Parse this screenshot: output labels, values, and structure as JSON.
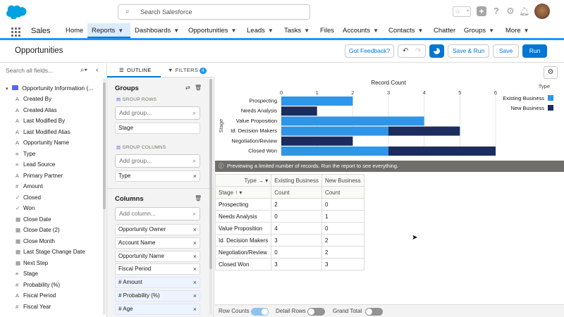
{
  "topbar": {
    "search_placeholder": "Search Salesforce",
    "icons": [
      "plus-icon",
      "help-icon",
      "gear-icon",
      "bell-icon"
    ]
  },
  "nav": {
    "app_name": "Sales",
    "items": [
      "Home",
      "Reports",
      "Dashboards",
      "Opportunities",
      "Leads",
      "Tasks",
      "Files",
      "Accounts",
      "Contacts",
      "Chatter",
      "Groups",
      "More"
    ]
  },
  "header": {
    "title": "Opportunities",
    "feedback": "Got Feedback?",
    "save_run": "Save & Run",
    "save": "Save",
    "run": "Run"
  },
  "fields": {
    "search_placeholder": "Search all fields...",
    "folder": "Opportunity Information (...",
    "items": [
      {
        "icon": "A",
        "label": "Created By"
      },
      {
        "icon": "A",
        "label": "Created Alias"
      },
      {
        "icon": "A",
        "label": "Last Modified By"
      },
      {
        "icon": "A",
        "label": "Last Modified Alias"
      },
      {
        "icon": "A",
        "label": "Opportunity Name"
      },
      {
        "icon": "≡",
        "label": "Type"
      },
      {
        "icon": "≡",
        "label": "Lead Source"
      },
      {
        "icon": "A",
        "label": "Primary Partner"
      },
      {
        "icon": "#",
        "label": "Amount"
      },
      {
        "icon": "✓",
        "label": "Closed"
      },
      {
        "icon": "✓",
        "label": "Won"
      },
      {
        "icon": "▦",
        "label": "Close Date"
      },
      {
        "icon": "▦",
        "label": "Close Date (2)"
      },
      {
        "icon": "▦",
        "label": "Close Month"
      },
      {
        "icon": "▦",
        "label": "Last Stage Change Date"
      },
      {
        "icon": "▦",
        "label": "Next Step"
      },
      {
        "icon": "≡",
        "label": "Stage"
      },
      {
        "icon": "#",
        "label": "Probability (%)"
      },
      {
        "icon": "A",
        "label": "Fiscal Period"
      },
      {
        "icon": "#",
        "label": "Fiscal Year"
      }
    ]
  },
  "outline": {
    "tab_outline": "OUTLINE",
    "tab_filters": "FILTERS",
    "filters_count": "4",
    "groups_title": "Groups",
    "group_rows_label": "GROUP ROWS",
    "add_group": "Add group...",
    "row_group": "Stage",
    "group_columns_label": "GROUP COLUMNS",
    "col_group": "Type",
    "columns_title": "Columns",
    "add_column": "Add column...",
    "columns": [
      {
        "label": "Opportunity Owner",
        "blue": false
      },
      {
        "label": "Account Name",
        "blue": false
      },
      {
        "label": "Opportunity Name",
        "blue": false
      },
      {
        "label": "Fiscal Period",
        "blue": false
      },
      {
        "label": "# Amount",
        "blue": true
      },
      {
        "label": "# Probability (%)",
        "blue": true
      },
      {
        "label": "# Age",
        "blue": true
      }
    ]
  },
  "chart_data": {
    "type": "bar",
    "orientation": "horizontal",
    "stacked": true,
    "title": "Record Count",
    "ylabel": "Stage",
    "xlim": [
      0,
      6
    ],
    "xticks": [
      0,
      1,
      2,
      3,
      4,
      5,
      6
    ],
    "categories": [
      "Prospecting",
      "Needs Analysis",
      "Value Proposition",
      "Id. Decision Makers",
      "Negotiation/Review",
      "Closed Won"
    ],
    "series": [
      {
        "name": "Existing Business",
        "color": "#2e95e9",
        "values": [
          2,
          0,
          4,
          3,
          0,
          3
        ]
      },
      {
        "name": "New Business",
        "color": "#1b2d5f",
        "values": [
          0,
          1,
          0,
          2,
          2,
          3
        ]
      }
    ],
    "legend_title": "Type",
    "legend_position": "right"
  },
  "infobar": "Previewing a limited number of records. Run the report to see everything.",
  "table": {
    "col_group_header": "Type",
    "row_group_header": "Stage",
    "col_headers": [
      "Existing Business",
      "New Business"
    ],
    "sub_headers": [
      "Count",
      "Count"
    ],
    "rows": [
      {
        "stage": "Prospecting",
        "v": [
          "2",
          "0"
        ]
      },
      {
        "stage": "Needs Analysis",
        "v": [
          "0",
          "1"
        ]
      },
      {
        "stage": "Value Proposition",
        "v": [
          "4",
          "0"
        ]
      },
      {
        "stage": "Id. Decision Makers",
        "v": [
          "3",
          "2"
        ]
      },
      {
        "stage": "Negotiation/Review",
        "v": [
          "0",
          "2"
        ]
      },
      {
        "stage": "Closed Won",
        "v": [
          "3",
          "3"
        ]
      }
    ]
  },
  "footer": {
    "row_counts": "Row Counts",
    "detail_rows": "Detail Rows",
    "grand_total": "Grand Total"
  }
}
